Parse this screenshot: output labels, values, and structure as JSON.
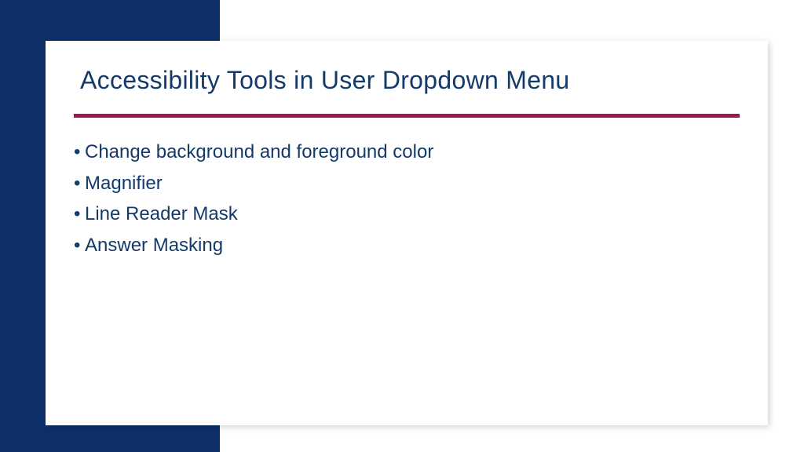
{
  "slide": {
    "title": "Accessibility Tools in User Dropdown Menu",
    "bullets": [
      "Change background and foreground color",
      "Magnifier",
      "Line Reader Mask",
      "Answer Masking"
    ]
  },
  "colors": {
    "band": "#0d3068",
    "rule": "#a31751",
    "text": "#143a6a"
  }
}
